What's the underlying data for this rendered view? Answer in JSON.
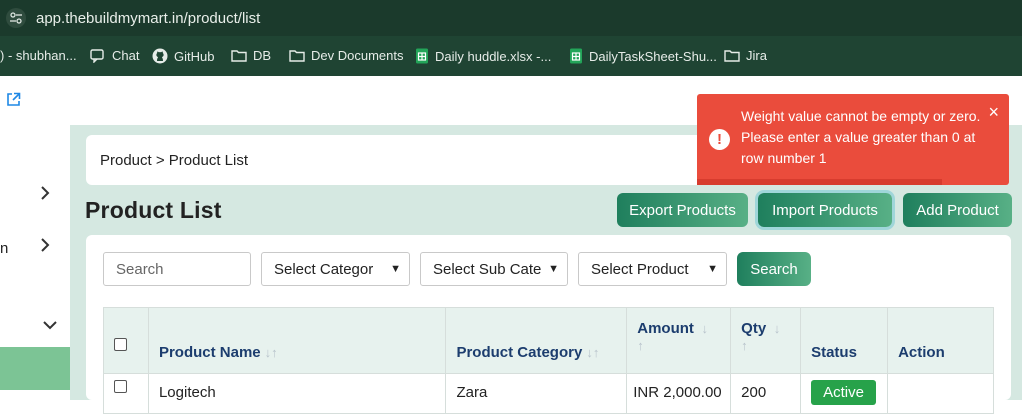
{
  "browser": {
    "url": "app.thebuildmymart.in/product/list",
    "bookmarks": [
      {
        "label": ") - shubhan...",
        "icon": "none"
      },
      {
        "label": "Chat",
        "icon": "chat-icon"
      },
      {
        "label": "GitHub",
        "icon": "github-icon"
      },
      {
        "label": "DB",
        "icon": "folder-icon"
      },
      {
        "label": "Dev Documents",
        "icon": "folder-icon"
      },
      {
        "label": "Daily huddle.xlsx -...",
        "icon": "sheets-icon"
      },
      {
        "label": "DailyTaskSheet-Shu...",
        "icon": "sheets-icon"
      },
      {
        "label": "Jira",
        "icon": "folder-icon"
      }
    ]
  },
  "sidebar": {
    "partial_text": "n"
  },
  "breadcrumb": "Product > Product List",
  "page_title": "Product List",
  "actions": {
    "export": "Export Products",
    "import": "Import Products",
    "add": "Add Product"
  },
  "filters": {
    "search_placeholder": "Search",
    "category": "Select Categor",
    "sub_category": "Select Sub Cate",
    "product": "Select Product",
    "search_button": "Search"
  },
  "table": {
    "headers": {
      "name": "Product Name",
      "category": "Product Category",
      "amount": "Amount",
      "qty": "Qty",
      "status": "Status",
      "action": "Action"
    },
    "rows": [
      {
        "name": "Logitech",
        "category": "Zara",
        "amount": "INR 2,000.00",
        "qty": "200",
        "status": "Active"
      }
    ]
  },
  "toast": {
    "message": "Weight value cannot be empty or zero. Please enter a value greater than 0 at row number 1",
    "close": "×",
    "icon": "!",
    "color": "#ea4c3c"
  },
  "colors": {
    "accent": "#1f7f5d",
    "content_bg": "#d5e8e1",
    "status_active": "#27a24a"
  }
}
